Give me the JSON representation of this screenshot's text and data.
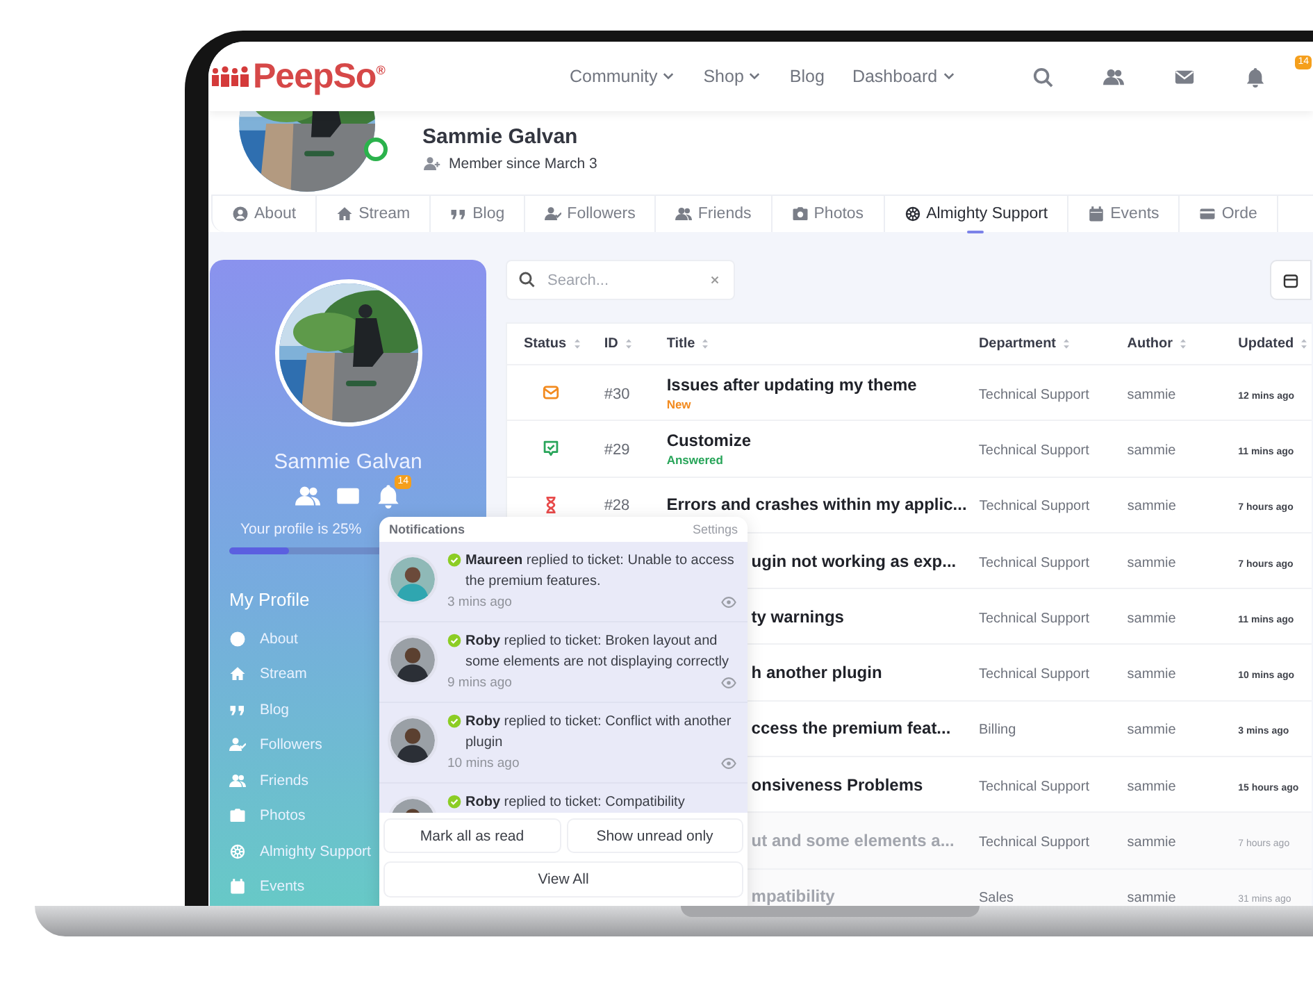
{
  "header": {
    "logo": "PeepSo$^{®}$",
    "nav": [
      {
        "label": "Community",
        "dropdown": true
      },
      {
        "label": "Shop",
        "dropdown": true
      },
      {
        "label": "Blog",
        "dropdown": false
      },
      {
        "label": "Dashboard",
        "dropdown": true
      }
    ],
    "bell_badge": "14"
  },
  "profile": {
    "name": "Sammie Galvan",
    "member_since": "Member since March 3",
    "online": true
  },
  "tabs": [
    {
      "label": "About",
      "selected": false
    },
    {
      "label": "Stream",
      "selected": false
    },
    {
      "label": "Blog",
      "selected": false
    },
    {
      "label": "Followers",
      "selected": false
    },
    {
      "label": "Friends",
      "selected": false
    },
    {
      "label": "Photos",
      "selected": false
    },
    {
      "label": "Almighty Support",
      "selected": true
    },
    {
      "label": "Events",
      "selected": false
    },
    {
      "label": "Orde",
      "selected": false
    }
  ],
  "sidebar": {
    "name": "Sammie Galvan",
    "bell_badge": "14",
    "completion": "Your profile is 25%",
    "progress": {
      "level": 0.24
    },
    "menu_title": "My Profile",
    "menu": [
      "About",
      "Stream",
      "Blog",
      "Followers",
      "Friends",
      "Photos",
      "Almighty Support",
      "Events"
    ]
  },
  "search": {
    "placeholder": "Search..."
  },
  "table": {
    "columns": [
      "Status",
      "ID",
      "Title",
      "Department",
      "Author",
      "Updated"
    ],
    "rows": [
      {
        "kind": "new",
        "id": "#30",
        "title": "Issues after updating my theme",
        "status_label": "New",
        "department": "Technical Support",
        "author": "sammie",
        "updated": "12 mins ago",
        "faded": false
      },
      {
        "kind": "answered",
        "id": "#29",
        "title": "Customize",
        "status_label": "Answered",
        "department": "Technical Support",
        "author": "sammie",
        "updated": "11 mins ago",
        "faded": false
      },
      {
        "kind": "pending",
        "id": "#28",
        "title": "Errors and crashes within my applic...",
        "department": "Technical Support",
        "author": "sammie",
        "updated": "7 hours ago",
        "faded": false
      },
      {
        "title": "ugin not working as exp...",
        "department": "Technical Support",
        "author": "sammie",
        "updated": "7 hours ago",
        "faded": false
      },
      {
        "title": "ty warnings",
        "department": "Technical Support",
        "author": "sammie",
        "updated": "11 mins ago",
        "faded": false
      },
      {
        "title": "h another plugin",
        "department": "Technical Support",
        "author": "sammie",
        "updated": "10 mins ago",
        "faded": false
      },
      {
        "title": "ccess the premium feat...",
        "department": "Billing",
        "author": "sammie",
        "updated": "3 mins ago",
        "faded": false
      },
      {
        "title": "onsiveness Problems",
        "department": "Technical Support",
        "author": "sammie",
        "updated": "15 hours ago",
        "faded": false
      },
      {
        "title": "ut and some elements a...",
        "department": "Technical Support",
        "author": "sammie",
        "updated": "7 hours ago",
        "faded": true
      },
      {
        "title": "mpatibility",
        "department": "Sales",
        "author": "sammie",
        "updated": "31 mins ago",
        "faded": true
      }
    ]
  },
  "notifications": {
    "title": "Notifications",
    "settings": "Settings",
    "items": [
      {
        "text": "**Maureen** replied to ticket: Unable to access the premium features.",
        "time": "3 mins ago"
      },
      {
        "text": "**Roby** replied to ticket: Broken layout and some elements are not displaying correctly",
        "time": "9 mins ago"
      },
      {
        "text": "**Roby** replied to ticket: Conflict with another plugin",
        "time": "10 mins ago"
      },
      {
        "text": "**Roby** replied to ticket: Compatibility"
      }
    ],
    "buttons": [
      "Mark all as read",
      "Show unread only"
    ],
    "view_all": "View All"
  }
}
